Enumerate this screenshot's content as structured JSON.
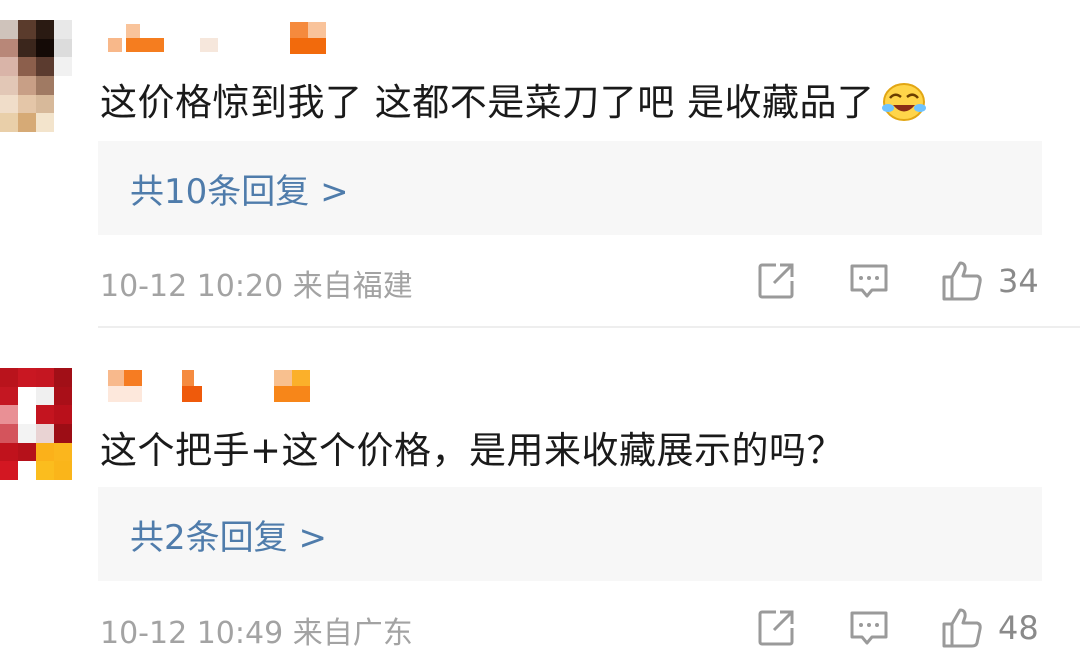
{
  "comments": [
    {
      "text": "这价格惊到我了 这都不是菜刀了吧 是收藏品了",
      "emoji": "laughing-crying-emoji",
      "reply_count_label": "共10条回复 >",
      "time": "10-12 10:20",
      "location": "来自福建",
      "likes": "34"
    },
    {
      "text": "这个把手+这个价格，是用来收藏展示的吗？",
      "reply_count_label": "共2条回复 >",
      "time": "10-12 10:49",
      "location": "来自广东",
      "likes": "48"
    }
  ],
  "icons": {
    "share": "share-icon",
    "comment": "comment-icon",
    "like": "thumbs-up-icon"
  },
  "colors": {
    "reply_link": "#4f7cab",
    "meta_text": "#a3a3a3",
    "reply_bg": "#f7f7f7",
    "nickname_orange": "#f5872a"
  }
}
